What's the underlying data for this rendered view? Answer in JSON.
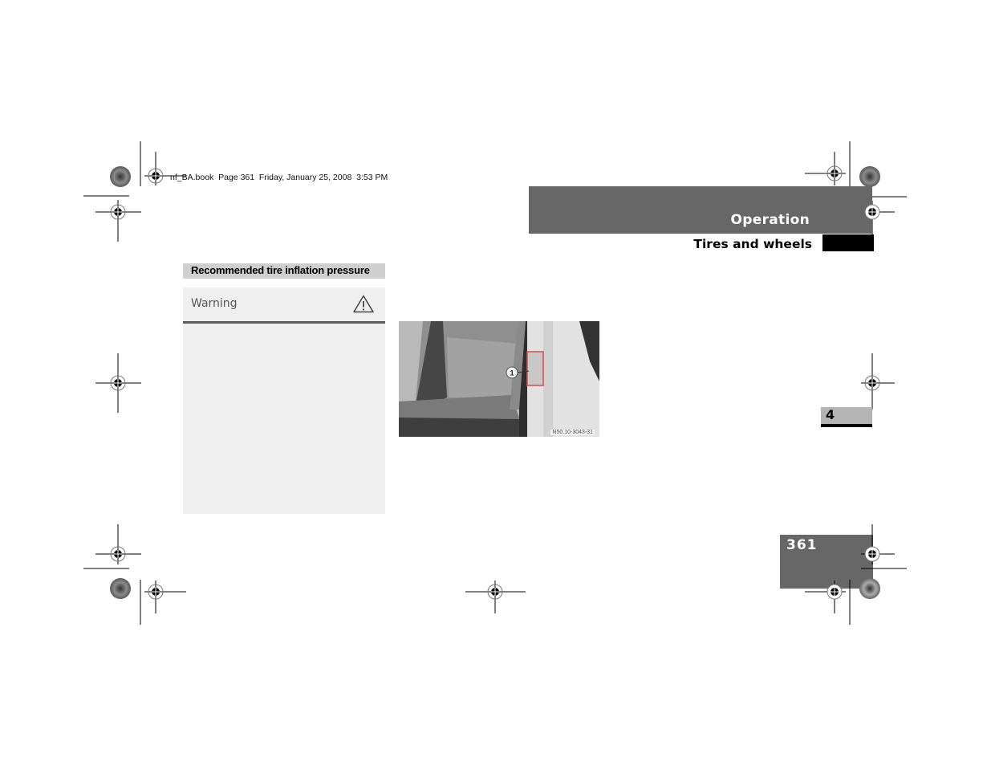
{
  "slug": "nf_BA.book  Page 361  Friday, January 25, 2008  3:53 PM",
  "header": {
    "chapter": "Operation",
    "section": "Tires and wheels"
  },
  "content": {
    "heading": "Recommended tire inflation pressure",
    "warning": {
      "label": "Warning",
      "icon": "warning-triangle-icon"
    },
    "figure": {
      "callout": "1",
      "caption": "N50.10-3043-31",
      "description": "Vehicle seat next to door B-pillar with tire pressure label highlighted",
      "highlight_color": "#d9534f"
    }
  },
  "thumb_tab": {
    "chapter_number": "4"
  },
  "footer": {
    "page_number": "361"
  },
  "colors": {
    "chapter_bar": "#676767",
    "heading_bar": "#cfcfcf",
    "warning_bg": "#efefef",
    "thumb_tab": "#b4b4b4"
  }
}
